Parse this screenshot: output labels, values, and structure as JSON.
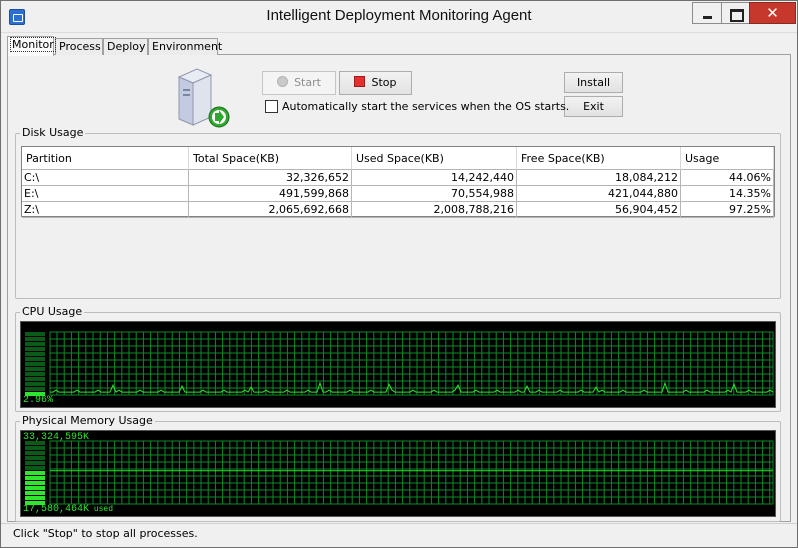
{
  "window": {
    "title": "Intelligent Deployment Monitoring Agent",
    "close_glyph": "✕"
  },
  "tabs": [
    "Monitor",
    "Process",
    "Deploy",
    "Environment"
  ],
  "controls": {
    "start_label": "Start",
    "stop_label": "Stop",
    "install_label": "Install",
    "exit_label": "Exit",
    "autostart_label": "Automatically start the services when the OS starts.",
    "autostart_checked": false
  },
  "disk": {
    "title": "Disk Usage",
    "headers": [
      "Partition",
      "Total Space(KB)",
      "Used Space(KB)",
      "Free Space(KB)",
      "Usage"
    ],
    "rows": [
      [
        "C:\\",
        "32,326,652",
        "14,242,440",
        "18,084,212",
        "44.06%"
      ],
      [
        "E:\\",
        "491,599,868",
        "70,554,988",
        "421,044,880",
        "14.35%"
      ],
      [
        "Z:\\",
        "2,065,692,668",
        "2,008,788,216",
        "56,904,452",
        "97.25%"
      ]
    ]
  },
  "cpu": {
    "title": "CPU Usage",
    "value_label": "2.96%",
    "level": 0.0296
  },
  "memory": {
    "title": "Physical Memory Usage",
    "total_label": "33,324,595K",
    "used_label": "17,580,464K",
    "used_suffix": "used",
    "level": 0.5276
  },
  "status": {
    "text": "Click \"Stop\" to stop all processes."
  },
  "colors": {
    "graph_green": "#2ee62e",
    "grid_green": "#0f8a2a",
    "close_red": "#c7382c",
    "stop_red": "#e53030"
  }
}
